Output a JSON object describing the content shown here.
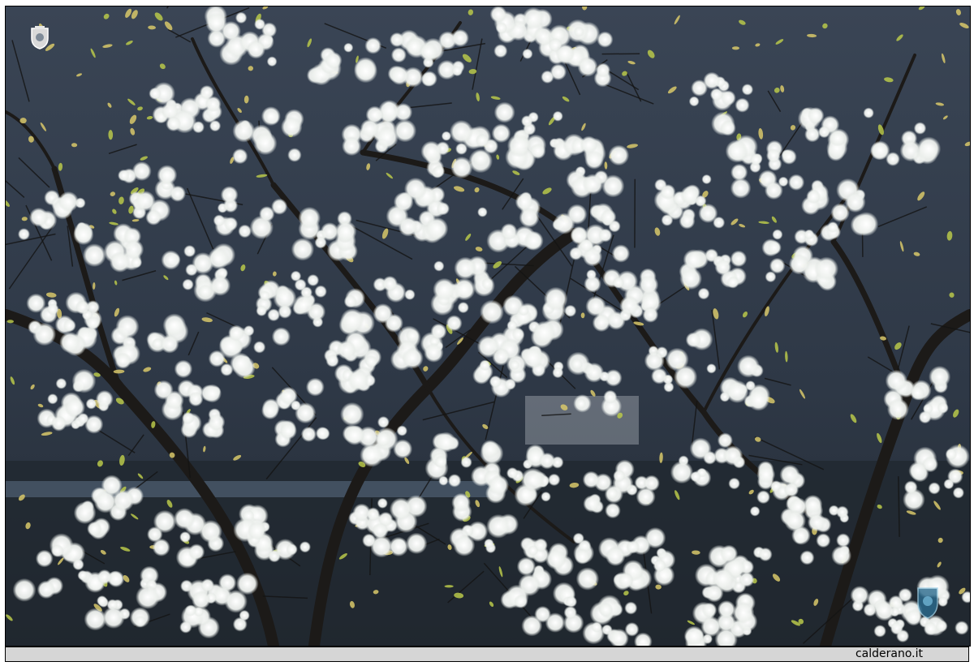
{
  "image": {
    "subject": "cherry-blossom-branches",
    "colors": {
      "sky": "#2f3a48",
      "blossom": "#f4f6f4",
      "leaf": "#b9c84a",
      "branch": "#1c1a18"
    }
  },
  "caption": {
    "text": "calderano.it"
  },
  "icons": {
    "top_left": "crest-icon",
    "bottom_right": "crest-icon"
  }
}
